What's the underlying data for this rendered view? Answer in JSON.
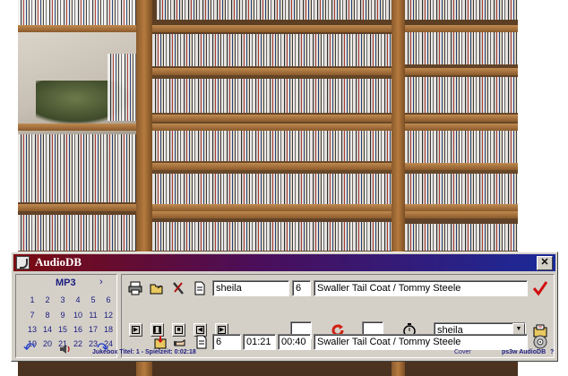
{
  "window": {
    "title": "AudioDB",
    "close_glyph": "✕"
  },
  "calendar": {
    "title": "MP3",
    "next_glyph": "›",
    "days": [
      "1",
      "2",
      "3",
      "4",
      "5",
      "6",
      "7",
      "8",
      "9",
      "10",
      "11",
      "12",
      "13",
      "14",
      "15",
      "16",
      "17",
      "18",
      "19",
      "20",
      "21",
      "22",
      "23",
      "24"
    ],
    "prev_arrow_icon": "undo-arrow-icon",
    "next_arrow_icon": "redo-arrow-icon",
    "speaker_icon": "speaker-icon"
  },
  "row1": {
    "search_value": "sheila",
    "track_no": "6",
    "title_value": "Swaller Tail Coat / Tommy Steele",
    "icons": [
      "printer-icon",
      "folder-open-icon",
      "tools-icon",
      "document-icon",
      "checkmark-icon"
    ],
    "accent": "#d01010"
  },
  "row2": {
    "box_a": "",
    "box_b": "",
    "artist_select": "sheila",
    "buttons": [
      "play",
      "pause",
      "stop",
      "prev",
      "next"
    ],
    "icons": [
      "repeat-icon",
      "timer-icon",
      "export-icon"
    ]
  },
  "row3": {
    "track_no": "6",
    "duration": "01:21",
    "position": "00:40",
    "title_value": "Swaller Tail Coat / Tommy Steele",
    "icons": [
      "import-icon",
      "hand-icon",
      "document-icon",
      "cd-icon"
    ]
  },
  "status": {
    "text": "Jukebox Titel: 1 -  Spielzeit: 0:02:18",
    "cover": "Cover",
    "brand": "ps3w AudioDB",
    "help": "?"
  }
}
